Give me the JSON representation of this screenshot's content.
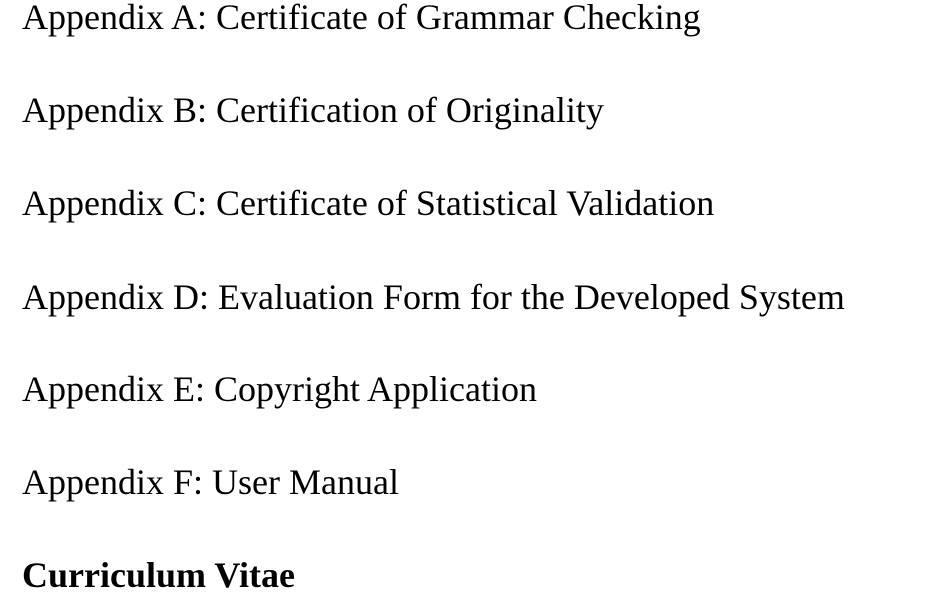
{
  "document": {
    "lines": [
      "Appendix A: Certificate of Grammar Checking",
      "Appendix B: Certification of Originality",
      "Appendix C: Certificate of Statistical Validation",
      "Appendix D: Evaluation Form for the Developed System",
      "Appendix E: Copyright Application",
      "Appendix F: User Manual"
    ],
    "final_heading": "Curriculum Vitae"
  }
}
